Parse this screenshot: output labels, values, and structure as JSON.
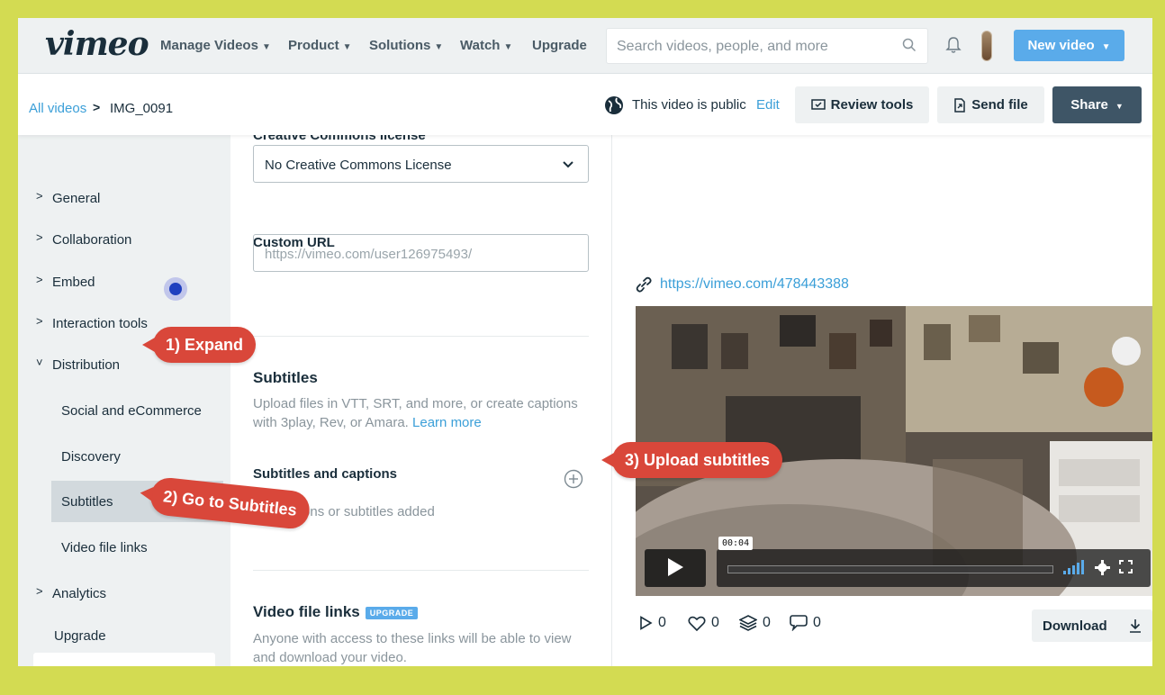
{
  "nav": {
    "logo": "vimeo",
    "items": [
      {
        "label": "Manage Videos",
        "chevron": true
      },
      {
        "label": "Product",
        "chevron": true
      },
      {
        "label": "Solutions",
        "chevron": true
      },
      {
        "label": "Watch",
        "chevron": true
      },
      {
        "label": "Upgrade",
        "chevron": false
      }
    ],
    "search_placeholder": "Search videos, people, and more",
    "new_video": "New video"
  },
  "subheader": {
    "breadcrumb_link": "All videos",
    "breadcrumb_sep": ">",
    "breadcrumb_current": "IMG_0091",
    "privacy_text": "This video is public",
    "edit": "Edit",
    "review_tools": "Review tools",
    "send_file": "Send file",
    "share": "Share"
  },
  "sidebar": {
    "items": [
      {
        "label": "General",
        "caret": ">"
      },
      {
        "label": "Collaboration",
        "caret": ">"
      },
      {
        "label": "Embed",
        "caret": ">"
      },
      {
        "label": "Interaction tools",
        "caret": ">"
      },
      {
        "label": "Distribution",
        "caret": "˅"
      }
    ],
    "subitems": [
      "Social and eCommerce",
      "Discovery",
      "Subtitles",
      "Video file links"
    ],
    "active_subitem": "Subtitles",
    "analytics": {
      "label": "Analytics",
      "caret": ">"
    },
    "upgrade": "Upgrade"
  },
  "form": {
    "cc_label": "Creative Commons license",
    "cc_value": "No Creative Commons License",
    "custom_url_label": "Custom URL",
    "custom_url_placeholder": "https://vimeo.com/user126975493/",
    "subtitles_title": "Subtitles",
    "subtitles_help": "Upload files in VTT, SRT, and more, or create captions with 3play, Rev, or Amara.",
    "learn_more": "Learn more",
    "captions_label": "Subtitles and captions",
    "captions_empty": "No captions or subtitles added",
    "file_links_title": "Video file links",
    "upgrade_badge": "UPGRADE",
    "file_links_help": "Anyone with access to these links will be able to view and download your video."
  },
  "video": {
    "url": "https://vimeo.com/478443388",
    "time": "00:04",
    "progress": 0.0,
    "stats": {
      "plays": "0",
      "likes": "0",
      "collections": "0",
      "comments": "0"
    },
    "download": "Download"
  },
  "annotations": {
    "step1": "1) Expand",
    "step2": "2) Go to Subtitles",
    "step3": "3) Upload subtitles"
  },
  "colors": {
    "background": "#d3db52",
    "accent": "#5aabea",
    "link": "#3b9fd8",
    "callout": "#d9473a",
    "share": "#3e5566"
  }
}
